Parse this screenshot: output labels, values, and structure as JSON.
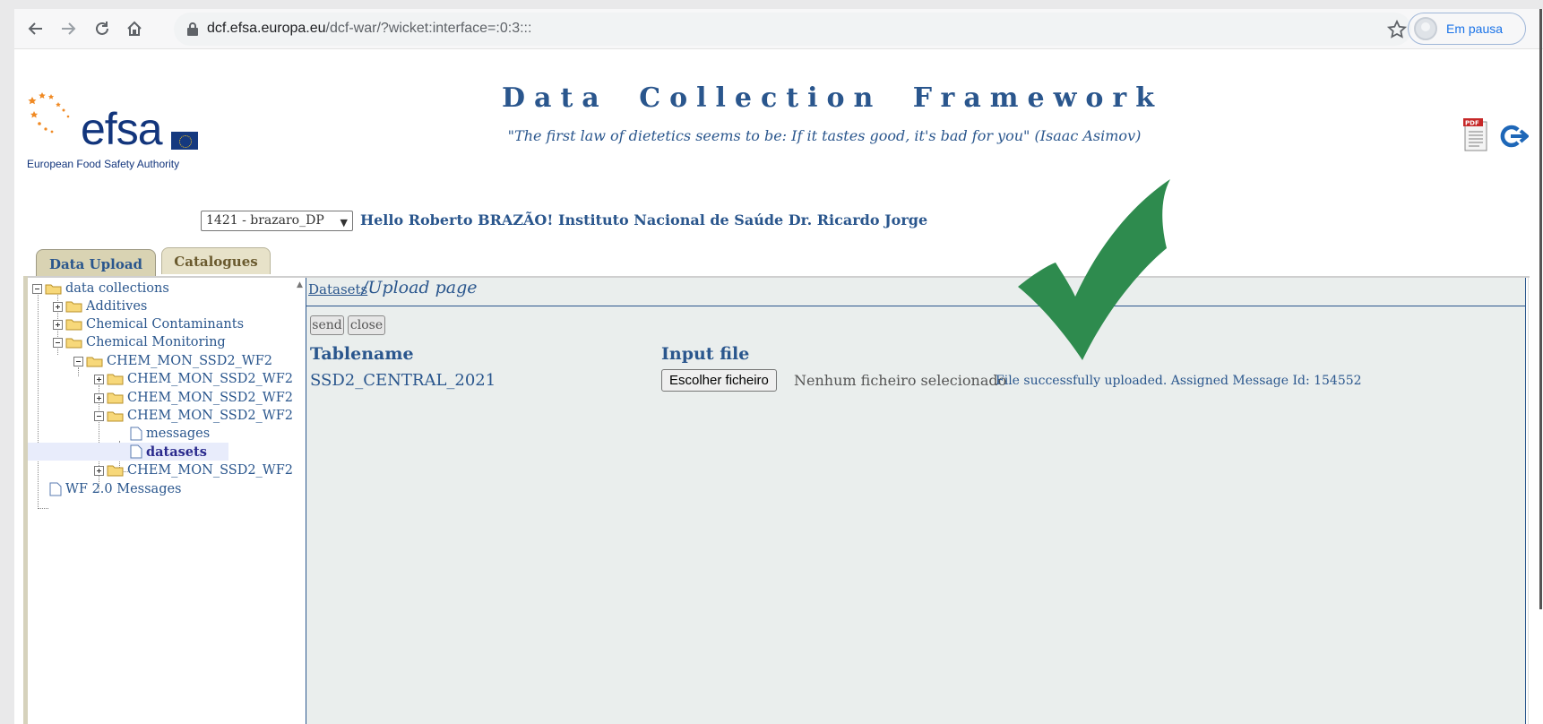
{
  "browser": {
    "url_host": "dcf.efsa.europa.eu",
    "url_path": "/dcf-war/?wicket:interface=:0:3:::",
    "profile_label": "Em pausa"
  },
  "header": {
    "logo_word": "efsa",
    "logo_tagline": "European Food Safety Authority",
    "title": "Data Collection Framework",
    "quote": "\"The first law of dietetics seems to be: If it tastes good, it's bad for you\" (Isaac Asimov)"
  },
  "userbar": {
    "selected_account": "1421 - brazaro_DP",
    "greeting": "Hello Roberto BRAZÃO! Instituto Nacional de Saúde Dr. Ricardo Jorge"
  },
  "tabs": [
    {
      "label": "Data Upload",
      "active": true
    },
    {
      "label": "Catalogues",
      "active": false
    }
  ],
  "tree": {
    "root": "data collections",
    "additives": "Additives",
    "chem_contaminants": "Chemical Contaminants",
    "chem_monitoring": "Chemical Monitoring",
    "chem_mon_wf2": "CHEM_MON_SSD2_WF2",
    "child1": "CHEM_MON_SSD2_WF2",
    "child2": "CHEM_MON_SSD2_WF2",
    "child3": "CHEM_MON_SSD2_WF2",
    "messages": "messages",
    "datasets": "datasets",
    "child4": "CHEM_MON_SSD2_WF2",
    "wf_messages": "WF 2.0 Messages"
  },
  "main": {
    "crumb_link": "Datasets",
    "crumb_current": "/Upload page",
    "send_label": "send",
    "close_label": "close",
    "col_tablename": "Tablename",
    "col_input": "Input file",
    "table_value": "SSD2_CENTRAL_2021",
    "file_button": "Escolher ficheiro",
    "no_file": "Nenhum ficheiro selecionado",
    "success_message": "File successfully uploaded. Assigned Message Id: 154552"
  },
  "colors": {
    "brand_blue": "#2a568d",
    "check_green": "#2e8b4e",
    "tab_bg": "#e7e2c9",
    "panel_bg": "#eaeeed"
  },
  "icons": [
    "back-icon",
    "forward-icon",
    "reload-icon",
    "home-icon",
    "lock-icon",
    "star-icon",
    "pdf-icon",
    "logout-icon",
    "folder-icon",
    "document-icon",
    "checkmark-icon"
  ]
}
